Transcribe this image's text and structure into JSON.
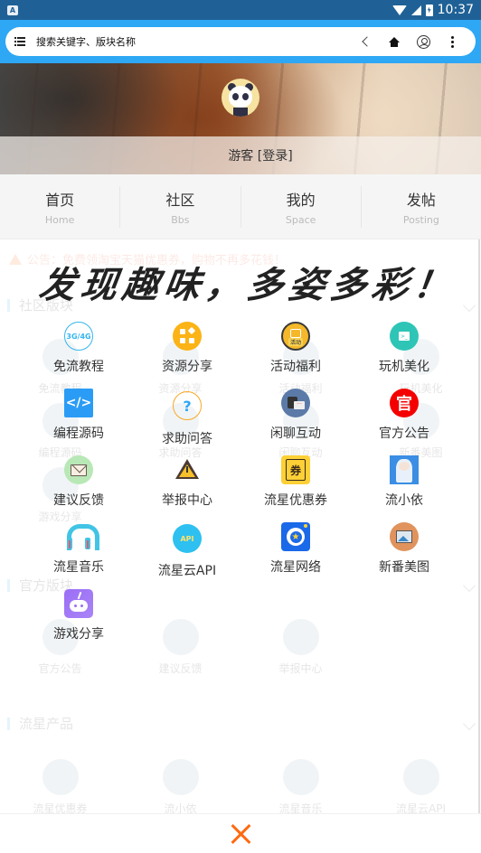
{
  "status_bar": {
    "app_badge": "A",
    "time": "10:37",
    "icons": [
      "wifi-icon",
      "signal-icon",
      "battery-charging-icon"
    ]
  },
  "browser": {
    "search_placeholder": "搜索关键字、版块名称",
    "buttons": [
      "menu-icon",
      "back-icon",
      "home-icon",
      "user-icon",
      "more-icon"
    ]
  },
  "header": {
    "user_label": "游客 [登录]",
    "avatar": "panda-avatar"
  },
  "nav_tabs": [
    {
      "label": "首页",
      "sub": "Home"
    },
    {
      "label": "社区",
      "sub": "Bbs"
    },
    {
      "label": "我的",
      "sub": "Space"
    },
    {
      "label": "发帖",
      "sub": "Posting"
    }
  ],
  "background": {
    "notice": "公告：免费领淘宝天猫优惠券，购物不再多花钱！",
    "sections": [
      {
        "title": "社区版块",
        "items": [
          "免流教程",
          "资源分享",
          "活动福利",
          "玩机美化",
          "编程源码",
          "求助问答",
          "闲聊互动",
          "新番美图",
          "游戏分享"
        ]
      },
      {
        "title": "官方版块",
        "items": [
          "官方公告",
          "建议反馈",
          "举报中心"
        ]
      },
      {
        "title": "流星产品",
        "items": [
          "流星优惠券",
          "流小依",
          "流星音乐",
          "流星云API"
        ]
      }
    ]
  },
  "overlay": {
    "slogan": "发现趣味，多姿多彩！",
    "items": [
      {
        "label": "免流教程",
        "icon": "3g4g-icon"
      },
      {
        "label": "资源分享",
        "icon": "apps-icon"
      },
      {
        "label": "活动福利",
        "icon": "activity-gift-icon",
        "badge": "活动"
      },
      {
        "label": "玩机美化",
        "icon": "terminal-icon"
      },
      {
        "label": "编程源码",
        "icon": "code-icon",
        "glyph": "</>"
      },
      {
        "label": "求助问答",
        "icon": "question-icon",
        "glyph": "?"
      },
      {
        "label": "闲聊互动",
        "icon": "chat-icon"
      },
      {
        "label": "官方公告",
        "icon": "official-icon",
        "glyph": "官"
      },
      {
        "label": "建议反馈",
        "icon": "envelope-icon"
      },
      {
        "label": "举报中心",
        "icon": "warning-icon"
      },
      {
        "label": "流星优惠券",
        "icon": "coupon-icon",
        "glyph": "券"
      },
      {
        "label": "流小依",
        "icon": "anime-girl-icon"
      },
      {
        "label": "流星音乐",
        "icon": "headphones-icon"
      },
      {
        "label": "流星云API",
        "icon": "api-icon",
        "glyph": "API"
      },
      {
        "label": "流星网络",
        "icon": "star-network-icon",
        "glyph": "★"
      },
      {
        "label": "新番美图",
        "icon": "picture-icon"
      },
      {
        "label": "游戏分享",
        "icon": "gamepad-icon"
      }
    ],
    "close_icon": "close-icon"
  },
  "colors": {
    "status_bar": "#1f6196",
    "browser_bar": "#2ea7f5",
    "close_accent": "#ff6a10"
  }
}
